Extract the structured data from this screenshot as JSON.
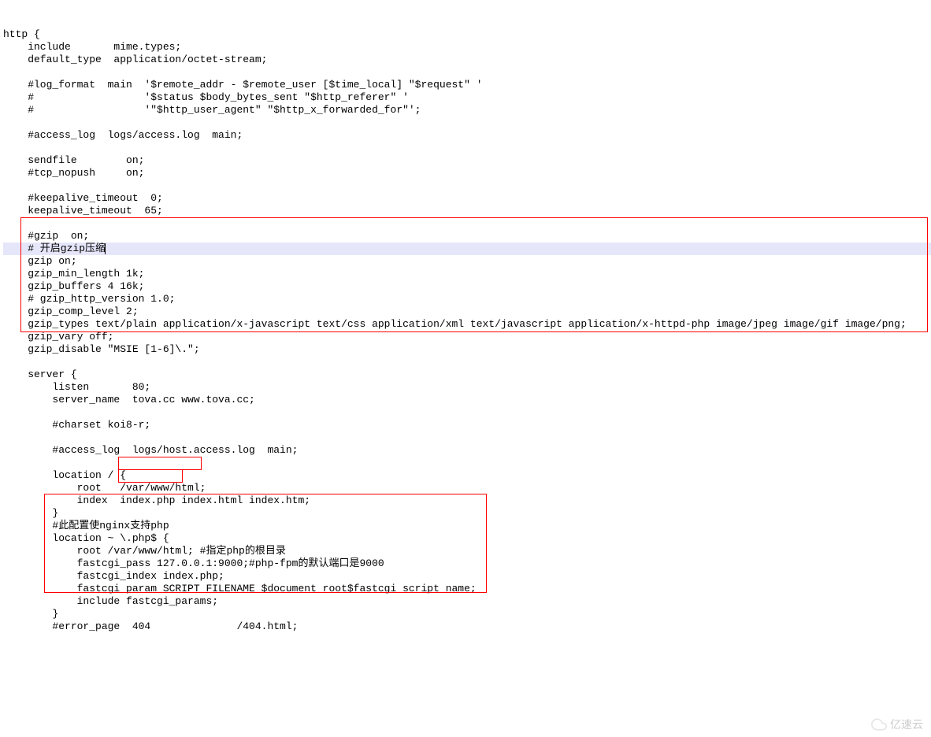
{
  "lines": [
    {
      "t": "http {",
      "cls": ""
    },
    {
      "t": "    include       mime.types;",
      "cls": ""
    },
    {
      "t": "    default_type  application/octet-stream;",
      "cls": ""
    },
    {
      "t": "",
      "cls": ""
    },
    {
      "t": "    #log_format  main  '$remote_addr - $remote_user [$time_local] \"$request\" '",
      "cls": ""
    },
    {
      "t": "    #                  '$status $body_bytes_sent \"$http_referer\" '",
      "cls": ""
    },
    {
      "t": "    #                  '\"$http_user_agent\" \"$http_x_forwarded_for\"';",
      "cls": ""
    },
    {
      "t": "",
      "cls": ""
    },
    {
      "t": "    #access_log  logs/access.log  main;",
      "cls": ""
    },
    {
      "t": "",
      "cls": ""
    },
    {
      "t": "    sendfile        on;",
      "cls": ""
    },
    {
      "t": "    #tcp_nopush     on;",
      "cls": ""
    },
    {
      "t": "",
      "cls": ""
    },
    {
      "t": "    #keepalive_timeout  0;",
      "cls": ""
    },
    {
      "t": "    keepalive_timeout  65;",
      "cls": ""
    },
    {
      "t": "",
      "cls": ""
    },
    {
      "t": "    #gzip  on;",
      "cls": ""
    },
    {
      "t": "    # 开启gzip压缩",
      "cls": "highlight",
      "caret": true
    },
    {
      "t": "    gzip on;",
      "cls": ""
    },
    {
      "t": "    gzip_min_length 1k;",
      "cls": ""
    },
    {
      "t": "    gzip_buffers 4 16k;",
      "cls": ""
    },
    {
      "t": "    # gzip_http_version 1.0;",
      "cls": ""
    },
    {
      "t": "    gzip_comp_level 2;",
      "cls": ""
    },
    {
      "t": "    gzip_types text/plain application/x-javascript text/css application/xml text/javascript application/x-httpd-php image/jpeg image/gif image/png;",
      "cls": ""
    },
    {
      "t": "    gzip_vary off;",
      "cls": ""
    },
    {
      "t": "    gzip_disable \"MSIE [1-6]\\.\";",
      "cls": ""
    },
    {
      "t": "",
      "cls": ""
    },
    {
      "t": "    server {",
      "cls": ""
    },
    {
      "t": "        listen       80;",
      "cls": ""
    },
    {
      "t": "        server_name  tova.cc www.tova.cc;",
      "cls": ""
    },
    {
      "t": "",
      "cls": ""
    },
    {
      "t": "        #charset koi8-r;",
      "cls": ""
    },
    {
      "t": "",
      "cls": ""
    },
    {
      "t": "        #access_log  logs/host.access.log  main;",
      "cls": ""
    },
    {
      "t": "",
      "cls": ""
    },
    {
      "t": "        location / {",
      "cls": ""
    },
    {
      "t": "            root   /var/www/html;",
      "cls": ""
    },
    {
      "t": "            index  index.php index.html index.htm;",
      "cls": ""
    },
    {
      "t": "        }",
      "cls": ""
    },
    {
      "t": "        #此配置使nginx支持php",
      "cls": ""
    },
    {
      "t": "        location ~ \\.php$ {",
      "cls": ""
    },
    {
      "t": "            root /var/www/html; #指定php的根目录",
      "cls": ""
    },
    {
      "t": "            fastcgi_pass 127.0.0.1:9000;#php-fpm的默认端口是9000",
      "cls": ""
    },
    {
      "t": "            fastcgi_index index.php;",
      "cls": ""
    },
    {
      "t": "            fastcgi_param SCRIPT_FILENAME $document_root$fastcgi_script_name;",
      "cls": ""
    },
    {
      "t": "            include fastcgi_params;",
      "cls": ""
    },
    {
      "t": "        }",
      "cls": ""
    },
    {
      "t": "        #error_page  404              /404.html;",
      "cls": ""
    }
  ],
  "watermark": "亿速云"
}
